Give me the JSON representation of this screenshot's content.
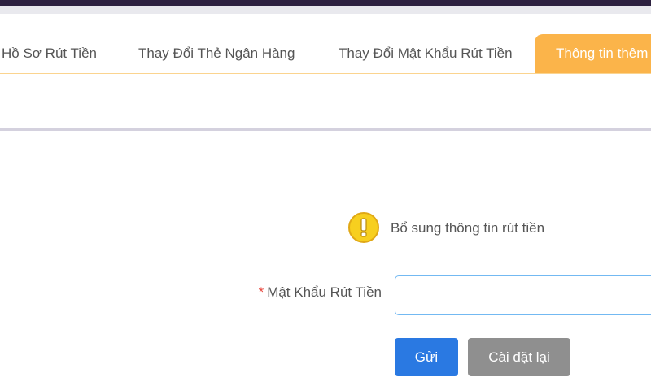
{
  "tabs": [
    {
      "label": "Hồ Sơ Rút Tiền",
      "active": false
    },
    {
      "label": "Thay Đổi Thẻ Ngân Hàng",
      "active": false
    },
    {
      "label": "Thay Đổi Mật Khẩu Rút Tiền",
      "active": false
    },
    {
      "label": "Thông tin thêm",
      "active": true
    }
  ],
  "notice": {
    "icon": "warning-exclamation-icon",
    "text": "Bổ sung thông tin rút tiền"
  },
  "form": {
    "required_marker": "*",
    "password_label": "Mật Khẩu Rút Tiền",
    "password_value": "",
    "password_placeholder": ""
  },
  "buttons": {
    "submit": "Gửi",
    "reset": "Cài đặt lại"
  },
  "colors": {
    "accent_tab": "#fbb44a",
    "primary_button": "#2a79e2",
    "secondary_button": "#8f8f8f",
    "required_marker": "#e8463c",
    "warning_icon": "#f7cf1f",
    "header_bar": "#2d2140"
  }
}
